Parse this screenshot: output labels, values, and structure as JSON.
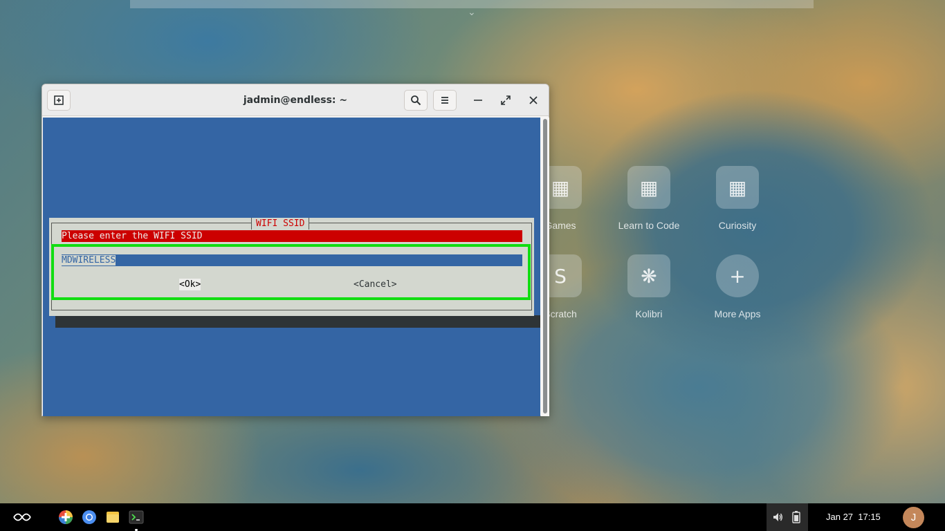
{
  "desktop": {
    "apps": [
      {
        "label": "Games",
        "icon": "games-folder-icon"
      },
      {
        "label": "Learn to Code",
        "icon": "learn-to-code-folder-icon"
      },
      {
        "label": "Curiosity",
        "icon": "curiosity-folder-icon"
      },
      {
        "label": "Scratch",
        "icon": "scratch-icon"
      },
      {
        "label": "Kolibri",
        "icon": "kolibri-icon"
      },
      {
        "label": "More Apps",
        "icon": "more-apps-icon"
      }
    ]
  },
  "window": {
    "title": "jadmin@endless: ~",
    "new_tab_icon": "new-tab-icon",
    "search_icon": "search-icon",
    "menu_icon": "hamburger-menu-icon",
    "minimize_icon": "minimize-icon",
    "maximize_icon": "maximize-icon",
    "close_icon": "close-icon"
  },
  "dialog": {
    "title": "WIFI SSID",
    "prompt": "Please enter the WIFI SSID",
    "input_value": "MDWIRELESS",
    "ok_label": "<Ok>",
    "cancel_label": "<Cancel>",
    "highlight_color": "#11dd11"
  },
  "taskbar": {
    "launcher_icon": "endless-logo-icon",
    "pinned": [
      {
        "name": "app-center",
        "icon": "app-center-icon"
      },
      {
        "name": "chromium",
        "icon": "chromium-icon"
      },
      {
        "name": "files",
        "icon": "files-icon"
      },
      {
        "name": "terminal",
        "icon": "terminal-icon"
      }
    ],
    "volume_icon": "volume-icon",
    "battery_icon": "battery-icon",
    "clock": "Jan 27  17:15",
    "user_initial": "J"
  }
}
